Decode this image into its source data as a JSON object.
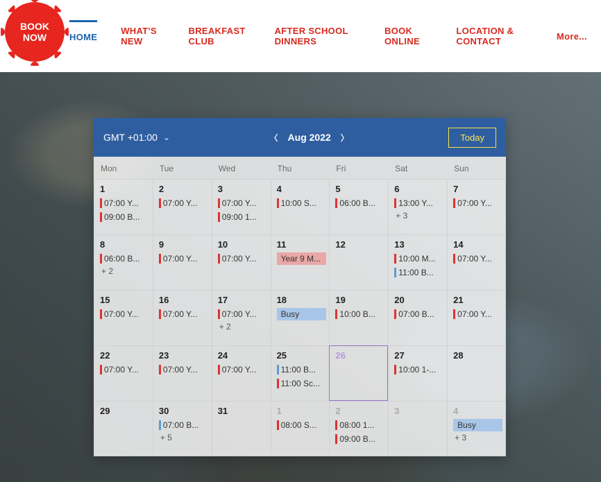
{
  "badge": {
    "line1": "BOOK",
    "line2": "NOW"
  },
  "nav": {
    "items": [
      {
        "label": "HOME",
        "active": true
      },
      {
        "label": "WHAT'S NEW"
      },
      {
        "label": "BREAKFAST CLUB"
      },
      {
        "label": "AFTER SCHOOL DINNERS"
      },
      {
        "label": "BOOK ONLINE"
      },
      {
        "label": "LOCATION & CONTACT"
      }
    ],
    "more": "More..."
  },
  "calendar": {
    "timezone": "GMT +01:00",
    "month_label": "Aug 2022",
    "today_label": "Today",
    "dow": [
      "Mon",
      "Tue",
      "Wed",
      "Thu",
      "Fri",
      "Sat",
      "Sun"
    ],
    "cells": [
      {
        "n": "1",
        "events": [
          {
            "t": "07:00 Y...",
            "c": "#d33"
          },
          {
            "t": "09:00 B...",
            "c": "#d33"
          }
        ]
      },
      {
        "n": "2",
        "events": [
          {
            "t": "07:00 Y...",
            "c": "#d33"
          }
        ]
      },
      {
        "n": "3",
        "events": [
          {
            "t": "07:00 Y...",
            "c": "#d33"
          },
          {
            "t": "09:00 1...",
            "c": "#d33"
          }
        ]
      },
      {
        "n": "4",
        "events": [
          {
            "t": "10:00 S...",
            "c": "#d33"
          }
        ]
      },
      {
        "n": "5",
        "events": [
          {
            "t": "06:00 B...",
            "c": "#d33"
          }
        ]
      },
      {
        "n": "6",
        "events": [
          {
            "t": "13:00 Y...",
            "c": "#d33"
          }
        ],
        "more": "+ 3"
      },
      {
        "n": "7",
        "events": [
          {
            "t": "07:00 Y...",
            "c": "#d33"
          }
        ]
      },
      {
        "n": "8",
        "events": [
          {
            "t": "06:00 B...",
            "c": "#d33"
          }
        ],
        "more": "+ 2"
      },
      {
        "n": "9",
        "events": [
          {
            "t": "07:00 Y...",
            "c": "#d33"
          }
        ]
      },
      {
        "n": "10",
        "events": [
          {
            "t": "07:00 Y...",
            "c": "#d33"
          }
        ]
      },
      {
        "n": "11",
        "events": [
          {
            "t": "Year 9 M...",
            "block": true,
            "bg": "#e9a7a7"
          }
        ]
      },
      {
        "n": "12",
        "events": []
      },
      {
        "n": "13",
        "events": [
          {
            "t": "10:00 M...",
            "c": "#d33"
          },
          {
            "t": "11:00 B...",
            "c": "#5a9bd5"
          }
        ]
      },
      {
        "n": "14",
        "events": [
          {
            "t": "07:00 Y...",
            "c": "#d33"
          }
        ]
      },
      {
        "n": "15",
        "events": [
          {
            "t": "07:00 Y...",
            "c": "#d33"
          }
        ]
      },
      {
        "n": "16",
        "events": [
          {
            "t": "07:00 Y...",
            "c": "#d33"
          }
        ]
      },
      {
        "n": "17",
        "events": [
          {
            "t": "07:00 Y...",
            "c": "#d33"
          }
        ],
        "more": "+ 2"
      },
      {
        "n": "18",
        "events": [
          {
            "t": "Busy",
            "block": true,
            "bg": "#a9c6e8"
          }
        ]
      },
      {
        "n": "19",
        "events": [
          {
            "t": "10:00 B...",
            "c": "#d33"
          }
        ]
      },
      {
        "n": "20",
        "events": [
          {
            "t": "07:00 B...",
            "c": "#d33"
          }
        ]
      },
      {
        "n": "21",
        "events": [
          {
            "t": "07:00 Y...",
            "c": "#d33"
          }
        ]
      },
      {
        "n": "22",
        "events": [
          {
            "t": "07:00 Y...",
            "c": "#d33"
          }
        ]
      },
      {
        "n": "23",
        "events": [
          {
            "t": "07:00 Y...",
            "c": "#d33"
          }
        ]
      },
      {
        "n": "24",
        "events": [
          {
            "t": "07:00 Y...",
            "c": "#d33"
          }
        ]
      },
      {
        "n": "25",
        "events": [
          {
            "t": "11:00 B...",
            "c": "#5a9bd5"
          },
          {
            "t": "11:00 Sc...",
            "c": "#d33"
          }
        ]
      },
      {
        "n": "26",
        "today": true,
        "events": []
      },
      {
        "n": "27",
        "events": [
          {
            "t": "10:00 1-...",
            "c": "#d33"
          }
        ]
      },
      {
        "n": "28",
        "events": []
      },
      {
        "n": "29",
        "events": []
      },
      {
        "n": "30",
        "events": [
          {
            "t": "07:00 B...",
            "c": "#5a9bd5"
          }
        ],
        "more": "+ 5"
      },
      {
        "n": "31",
        "events": []
      },
      {
        "n": "1",
        "other": true,
        "events": [
          {
            "t": "08:00 S...",
            "c": "#d33"
          }
        ]
      },
      {
        "n": "2",
        "other": true,
        "events": [
          {
            "t": "08:00 1...",
            "c": "#d33"
          },
          {
            "t": "09:00 B...",
            "c": "#d33"
          }
        ]
      },
      {
        "n": "3",
        "other": true,
        "events": []
      },
      {
        "n": "4",
        "other": true,
        "events": [
          {
            "t": "Busy",
            "block": true,
            "bg": "#a9c6e8"
          }
        ],
        "more": "+ 3"
      }
    ]
  }
}
